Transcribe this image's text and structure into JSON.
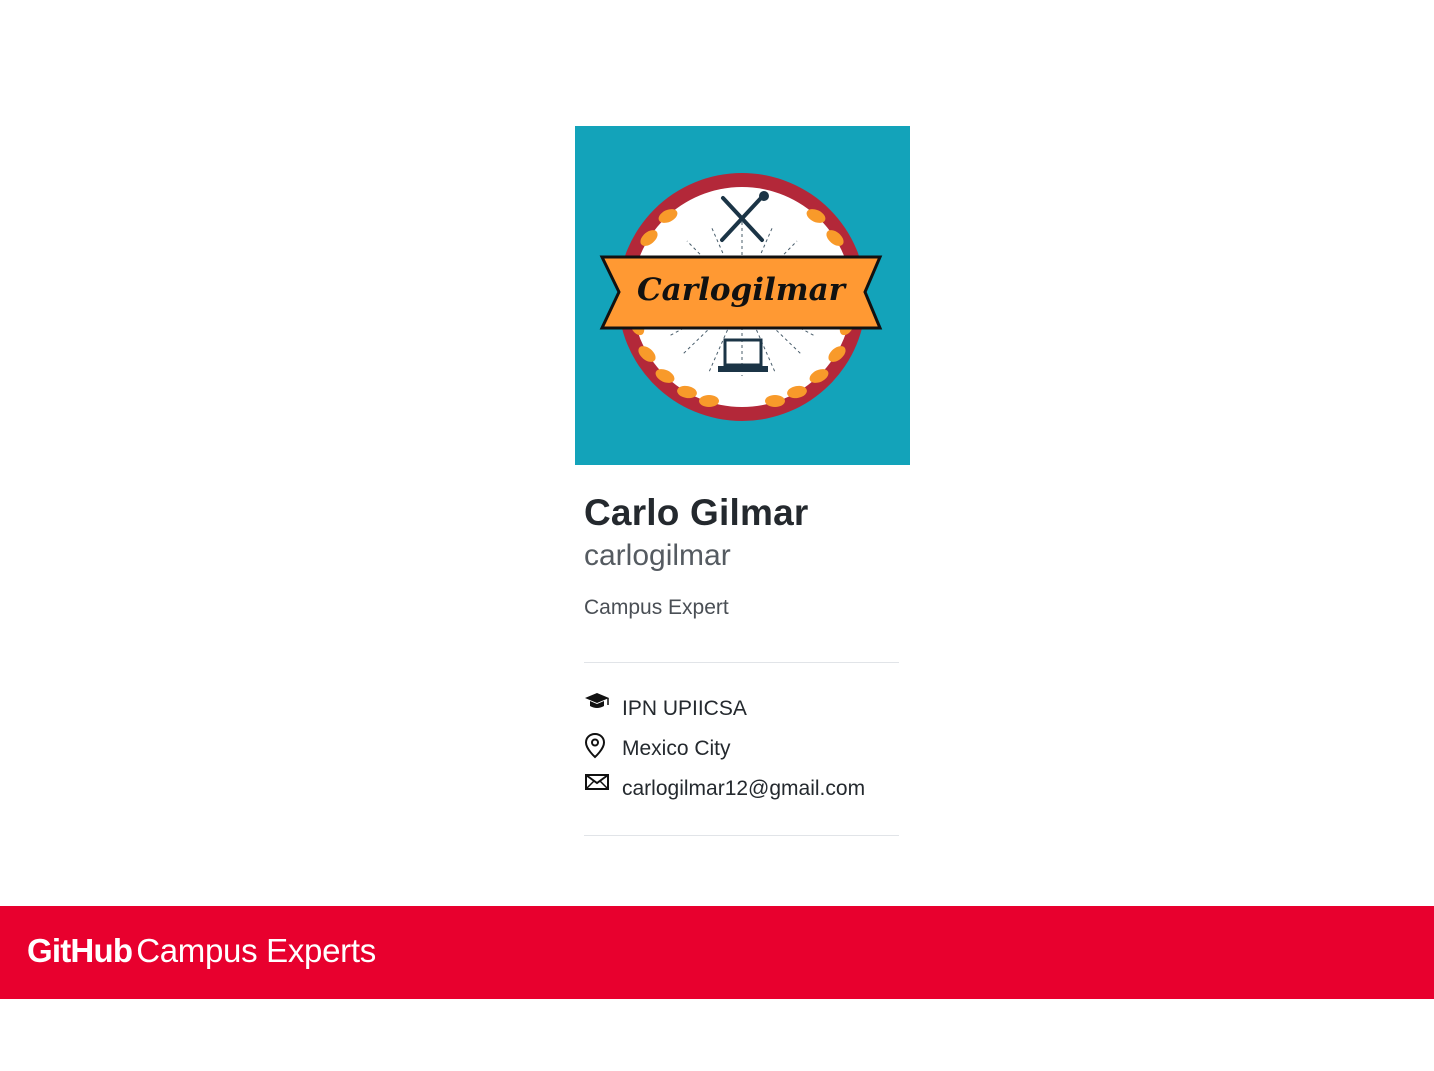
{
  "profile": {
    "avatar": {
      "badge_text": "Carlogilmar",
      "colors": {
        "background": "#13a3ba",
        "ring": "#b32839",
        "ribbon": "#ff9933",
        "leaf": "#f89a2a",
        "ink": "#1b3446"
      }
    },
    "name": "Carlo Gilmar",
    "login": "carlogilmar",
    "role": "Campus Expert",
    "meta": {
      "school": "IPN UPIICSA",
      "location": "Mexico City",
      "email": "carlogilmar12@gmail.com"
    }
  },
  "footer": {
    "brand": "GitHub",
    "product": "Campus Experts",
    "background_color": "#e8002e"
  }
}
